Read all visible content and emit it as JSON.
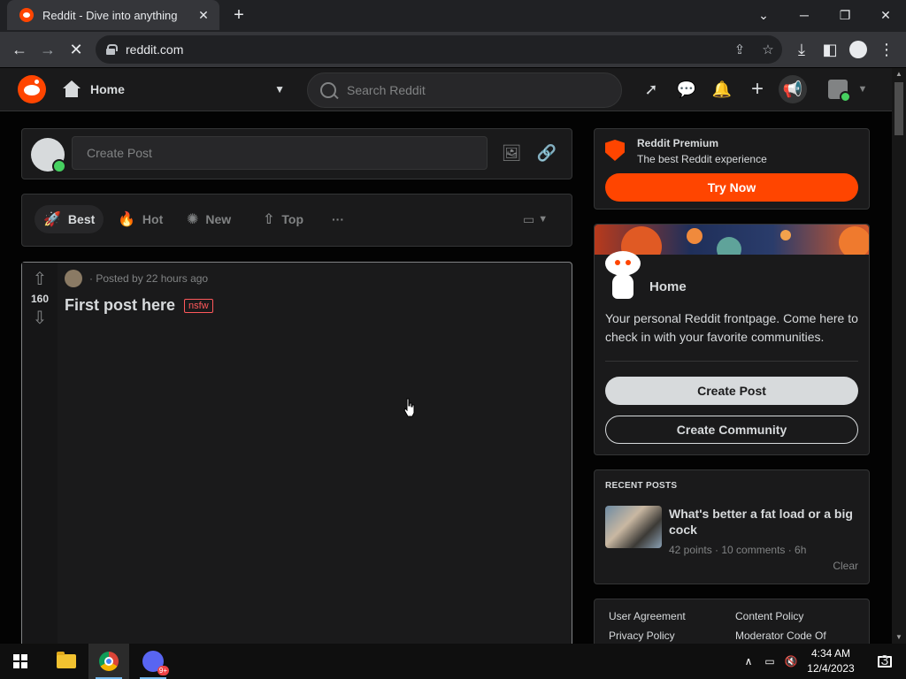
{
  "browser": {
    "tab_title": "Reddit - Dive into anything",
    "url": "reddit.com"
  },
  "header": {
    "home_label": "Home",
    "search_placeholder": "Search Reddit"
  },
  "create_post": {
    "placeholder": "Create Post"
  },
  "sort_tabs": [
    {
      "label": "Best",
      "active": true
    },
    {
      "label": "Hot",
      "active": false
    },
    {
      "label": "New",
      "active": false
    },
    {
      "label": "Top",
      "active": false
    }
  ],
  "post": {
    "score": "160",
    "posted_by": "· Posted by 22 hours ago",
    "title": "First post here",
    "tag": "nsfw"
  },
  "premium": {
    "title": "Reddit Premium",
    "subtitle": "The best Reddit experience",
    "cta": "Try Now"
  },
  "home_card": {
    "title": "Home",
    "description": "Your personal Reddit frontpage. Come here to check in with your favorite communities.",
    "create_post": "Create Post",
    "create_community": "Create Community"
  },
  "recent_posts": {
    "heading": "RECENT POSTS",
    "items": [
      {
        "title": "What's better a fat load or a big cock",
        "meta": "42 points · 10 comments · 6h"
      }
    ],
    "clear": "Clear"
  },
  "footer_links": [
    "User Agreement",
    "Content Policy",
    "Privacy Policy",
    "Moderator Code Of"
  ],
  "taskbar": {
    "time": "4:34 AM",
    "date": "12/4/2023",
    "discord_badge": "9+",
    "notification_count": "3"
  },
  "colors": {
    "accent": "#ff4500",
    "background": "#030303",
    "card": "#1a1a1b",
    "nsfw": "#ff585b",
    "online": "#46d160"
  }
}
